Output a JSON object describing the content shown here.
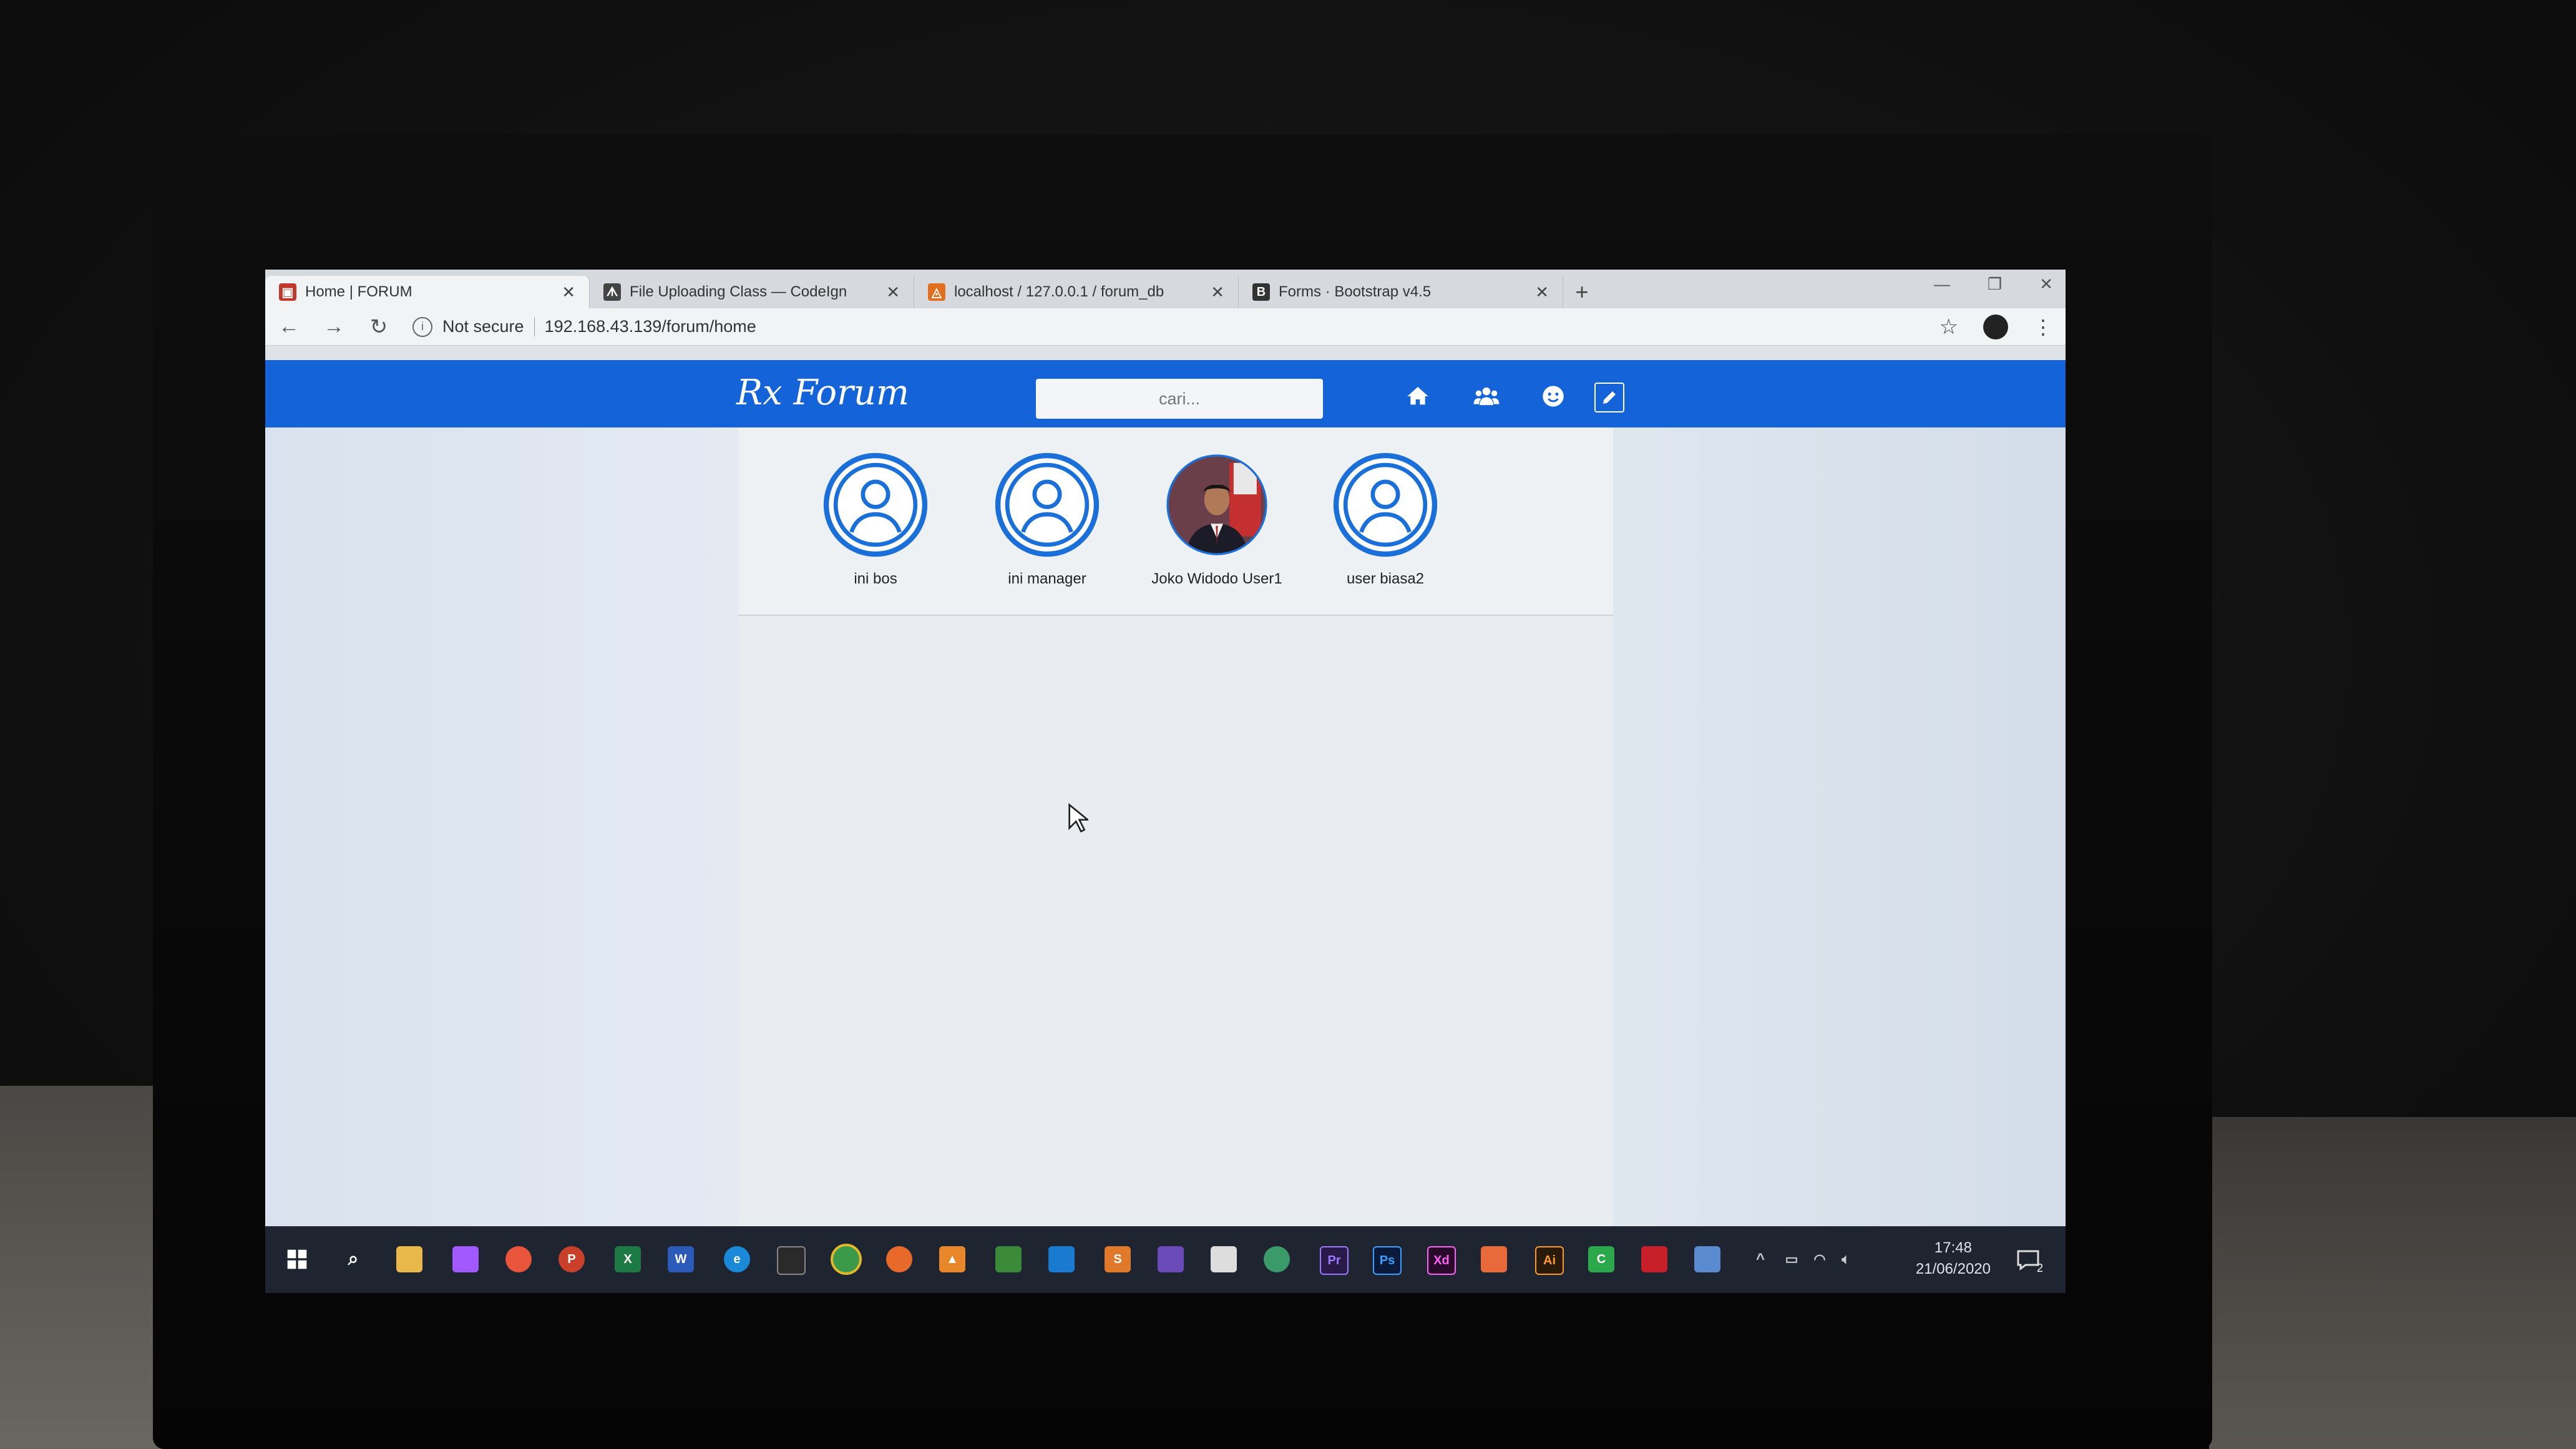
{
  "browser": {
    "tabs": [
      {
        "label": "Home | FORUM",
        "active": true,
        "favicon": "forum-favicon",
        "color": "#c0392b"
      },
      {
        "label": "File Uploading Class — CodeIgn",
        "active": false,
        "favicon": "codeigniter-favicon",
        "color": "#444444"
      },
      {
        "label": "localhost / 127.0.0.1 / forum_db",
        "active": false,
        "favicon": "phpmyadmin-favicon",
        "color": "#e07020"
      },
      {
        "label": "Forms · Bootstrap v4.5",
        "active": false,
        "favicon": "bootstrap-favicon",
        "color": "#333333"
      }
    ],
    "new_tab": "+",
    "security_label": "Not secure",
    "url": "192.168.43.139/forum/home"
  },
  "site": {
    "brand": "Rx Forum",
    "search_placeholder": "cari...",
    "header_color": "#1463d9",
    "nav_icons": [
      "home-icon",
      "users-icon",
      "smiley-icon",
      "edit-icon"
    ]
  },
  "users": [
    {
      "name": "ini bos",
      "avatar": "default-avatar"
    },
    {
      "name": "ini manager",
      "avatar": "default-avatar"
    },
    {
      "name": "Joko Widodo User1",
      "avatar": "photo-avatar"
    },
    {
      "name": "user biasa2",
      "avatar": "default-avatar"
    }
  ],
  "taskbar": {
    "time": "17:48",
    "date": "21/06/2020",
    "notification_count": "2"
  }
}
